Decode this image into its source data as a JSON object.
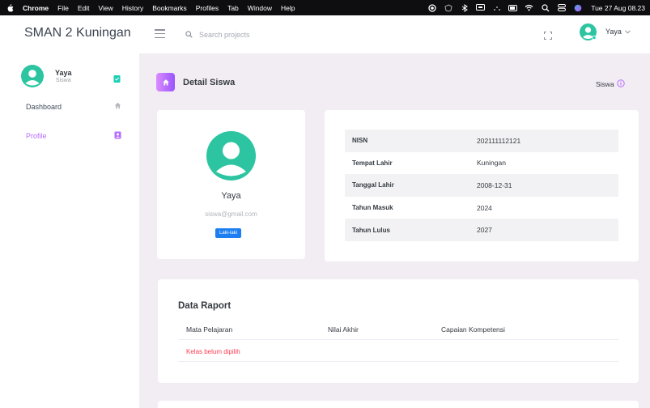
{
  "menubar": {
    "items": [
      "Chrome",
      "File",
      "Edit",
      "View",
      "History",
      "Bookmarks",
      "Profiles",
      "Tab",
      "Window",
      "Help"
    ],
    "clock": "Tue 27 Aug 08.23"
  },
  "navbar": {
    "brand": "SMAN 2 Kuningan",
    "search_placeholder": "Search projects",
    "user_name": "Yaya",
    "user_caret": "⌄"
  },
  "sidebar": {
    "profile_name": "Yaya",
    "profile_role": "Siswa",
    "items": [
      {
        "label": "Dashboard"
      },
      {
        "label": "Profile"
      }
    ]
  },
  "page": {
    "title": "Detail Siswa",
    "breadcrumb": "Siswa"
  },
  "student": {
    "name": "Yaya",
    "email": "siswa@gmail.com",
    "gender": "Laki-laki"
  },
  "info": [
    {
      "key": "NISN",
      "value": "202111112121"
    },
    {
      "key": "Tempat Lahir",
      "value": "Kuningan"
    },
    {
      "key": "Tanggal Lahir",
      "value": "2008-12-31"
    },
    {
      "key": "Tahun Masuk",
      "value": "2024"
    },
    {
      "key": "Tahun Lulus",
      "value": "2027"
    }
  ],
  "raport": {
    "title": "Data Raport",
    "columns": [
      "Mata Pelajaran",
      "Nilai Akhir",
      "Capaian Kompetensi"
    ],
    "empty_message": "Kelas belum dipilih"
  },
  "colors": {
    "accent": "#b66dff",
    "avatar": "#2dc5a1",
    "badge": "#1c7ef0",
    "danger": "#fe3e52"
  }
}
